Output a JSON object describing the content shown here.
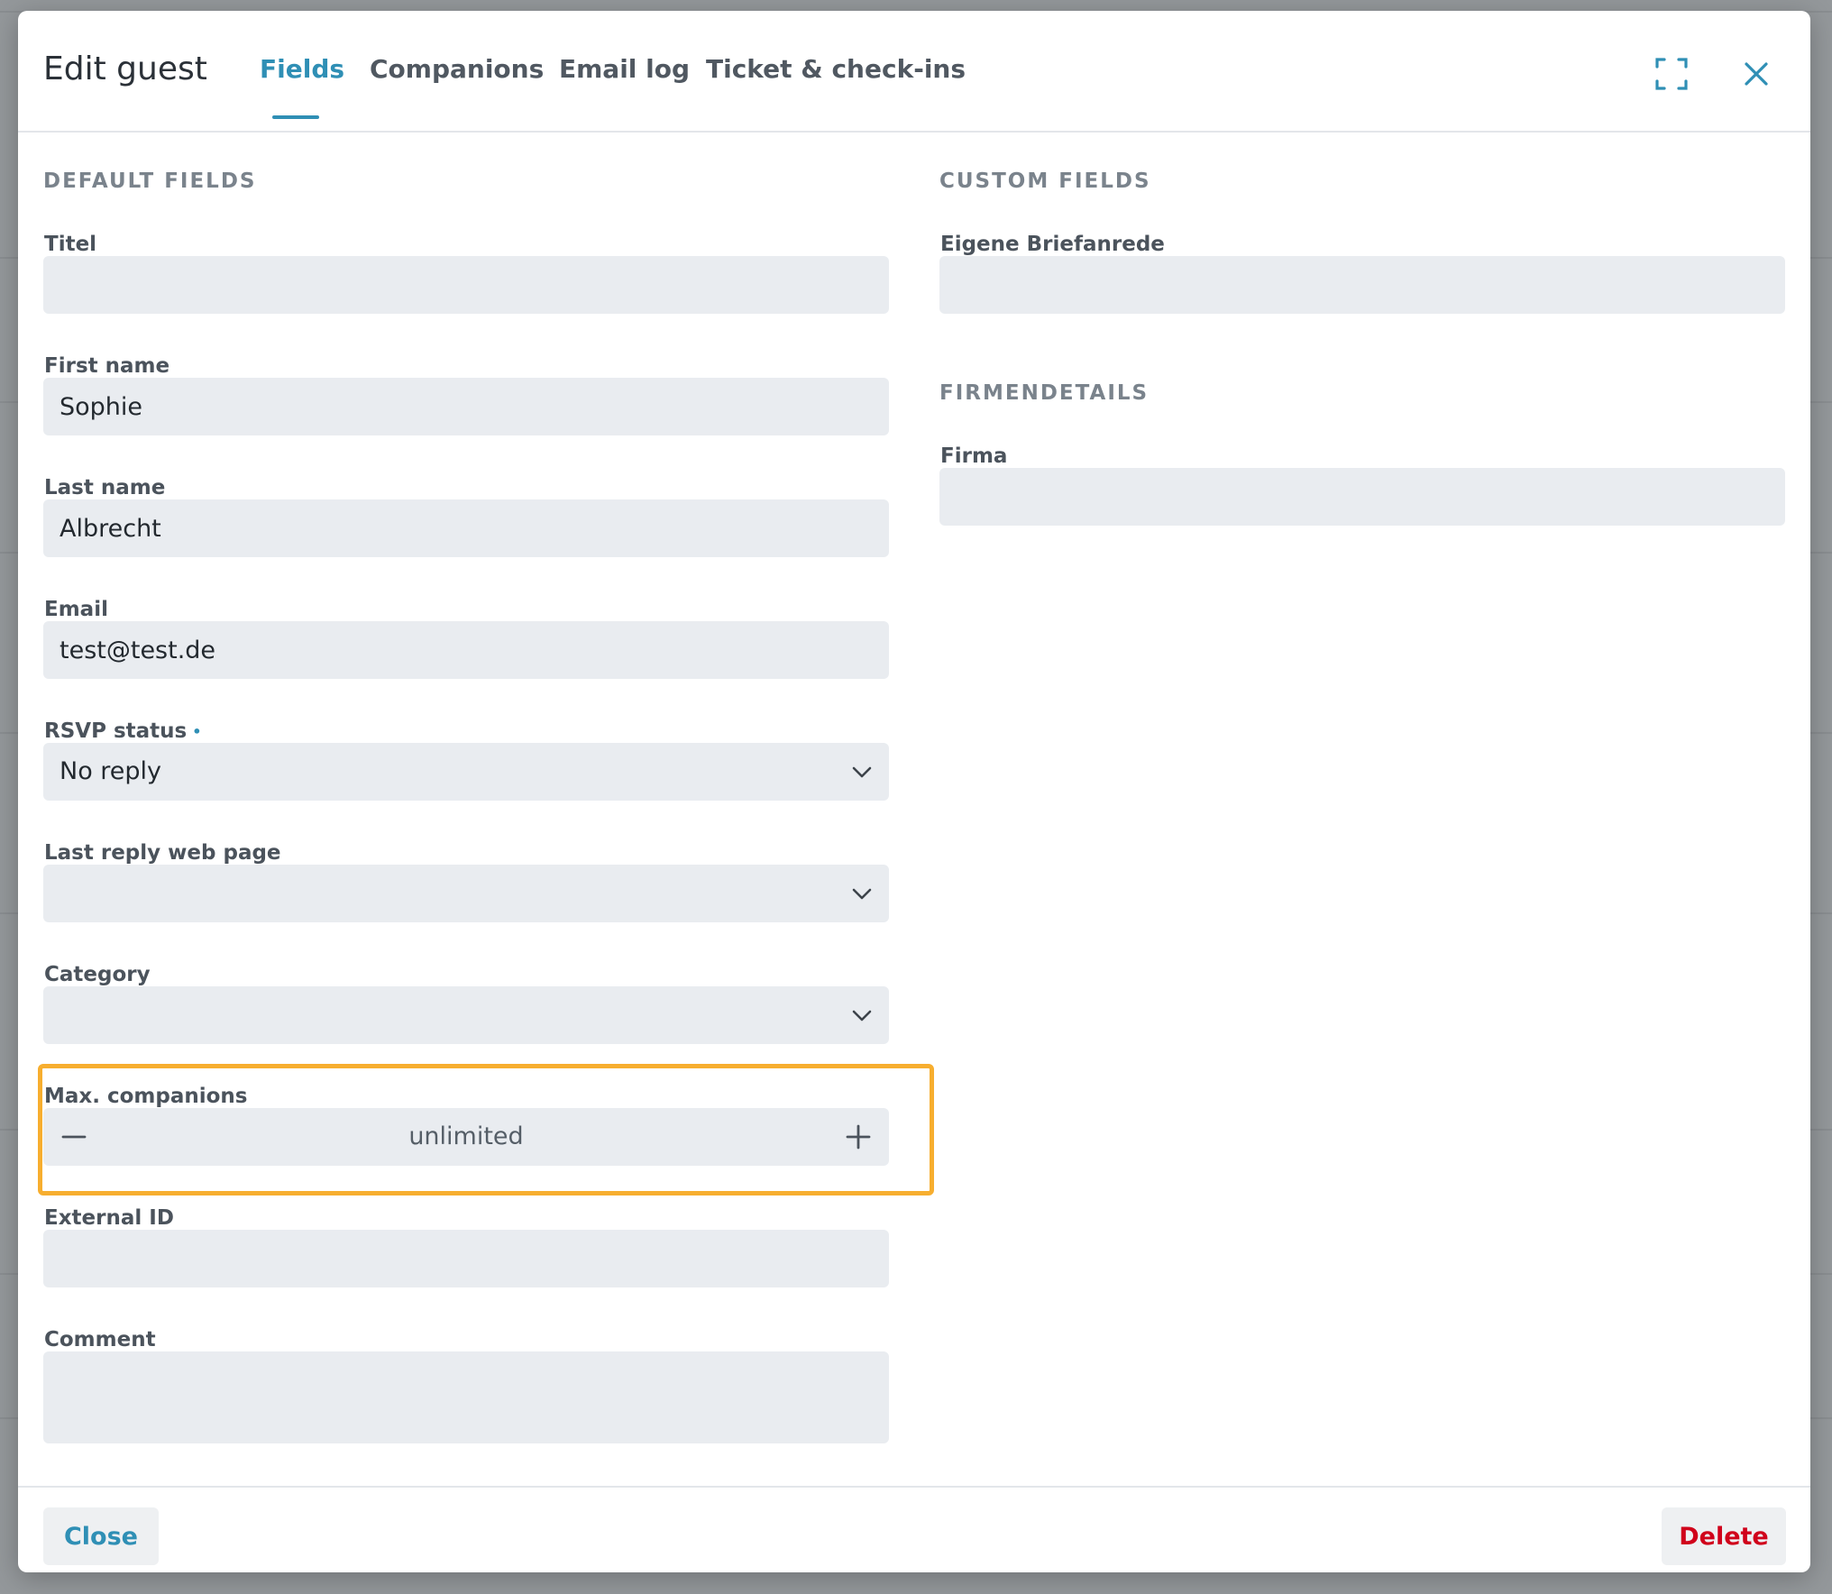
{
  "modal": {
    "title": "Edit guest",
    "tabs": [
      {
        "label": "Fields",
        "active": true
      },
      {
        "label": "Companions",
        "active": false
      },
      {
        "label": "Email log",
        "active": false
      },
      {
        "label": "Ticket & check-ins",
        "active": false
      }
    ],
    "icons": {
      "expand": "expand-icon",
      "close": "close-icon"
    }
  },
  "default_fields": {
    "heading": "DEFAULT FIELDS",
    "titel": {
      "label": "Titel",
      "value": ""
    },
    "first_name": {
      "label": "First name",
      "value": "Sophie"
    },
    "last_name": {
      "label": "Last name",
      "value": "Albrecht"
    },
    "email": {
      "label": "Email",
      "value": "test@test.de"
    },
    "rsvp_status": {
      "label": "RSVP status",
      "required_marker": "•",
      "value": "No reply"
    },
    "last_reply_web_page": {
      "label": "Last reply web page",
      "value": ""
    },
    "category": {
      "label": "Category",
      "value": ""
    },
    "max_companions": {
      "label": "Max. companions",
      "value": "unlimited"
    },
    "external_id": {
      "label": "External ID",
      "value": ""
    },
    "comment": {
      "label": "Comment",
      "value": ""
    }
  },
  "custom_fields": {
    "heading": "CUSTOM FIELDS",
    "eigene_briefanrede": {
      "label": "Eigene Briefanrede",
      "value": ""
    },
    "firmendetails_heading": "FIRMENDETAILS",
    "firma": {
      "label": "Firma",
      "value": ""
    }
  },
  "footer": {
    "close_label": "Close",
    "delete_label": "Delete"
  },
  "colors": {
    "accent": "#2f8fb5",
    "danger": "#d0021b",
    "highlight": "#f7ae2f",
    "field_bg": "#e9ecf0"
  }
}
